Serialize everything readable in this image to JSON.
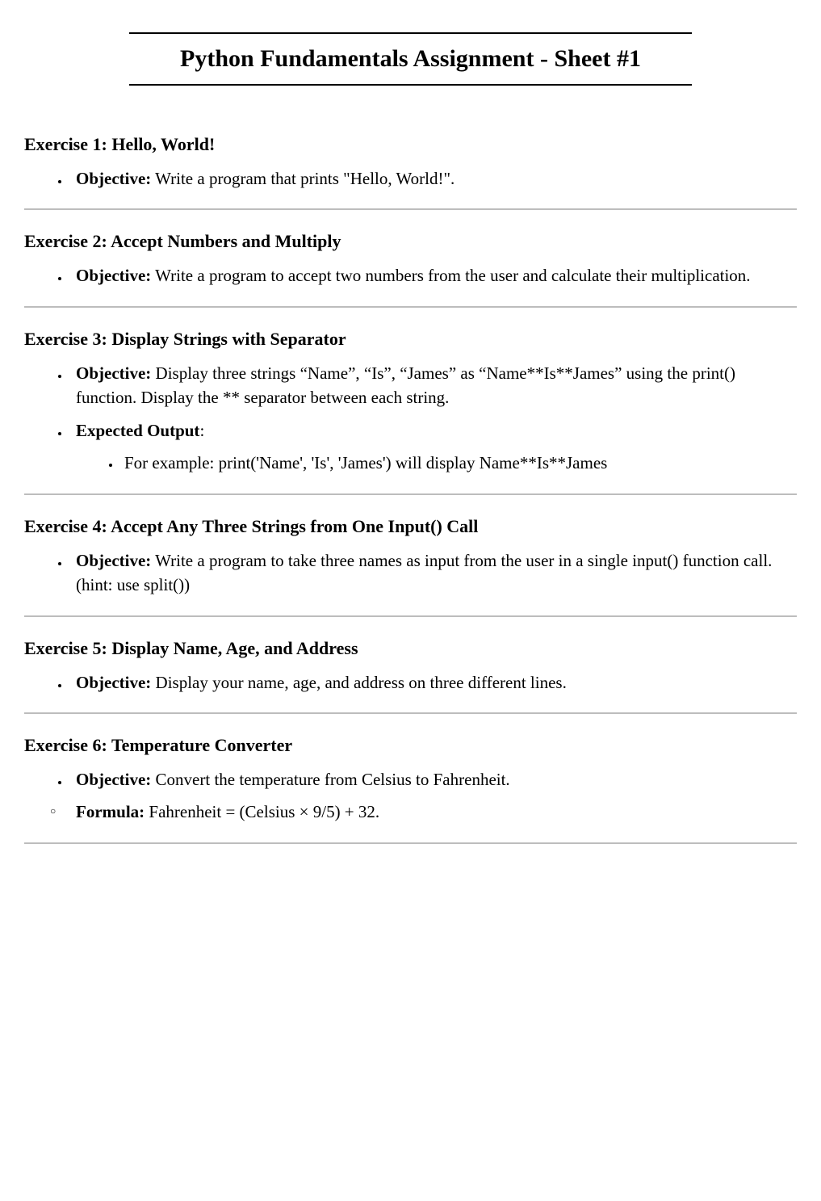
{
  "title": "Python Fundamentals Assignment - Sheet #1",
  "exercises": [
    {
      "heading": "Exercise 1: Hello, World!",
      "items": [
        {
          "type": "disc",
          "label": "Objective:",
          "text": " Write a program that prints \"Hello, World!\"."
        }
      ]
    },
    {
      "heading": "Exercise 2: Accept Numbers and Multiply",
      "items": [
        {
          "type": "disc",
          "label": "Objective:",
          "text": " Write a program to accept two numbers from the user and calculate their multiplication."
        }
      ]
    },
    {
      "heading": "Exercise 3: Display Strings with Separator",
      "items": [
        {
          "type": "disc",
          "label": "Objective:",
          "text": " Display three strings “Name”, “Is”, “James” as “Name**Is**James” using the print() function. Display the ** separator between each string."
        },
        {
          "type": "disc",
          "label": "Expected Output",
          "labelSuffix": ":",
          "text": "",
          "subitems": [
            {
              "text": "For example: print('Name', 'Is', 'James') will display Name**Is**James"
            }
          ]
        }
      ]
    },
    {
      "heading": "Exercise 4: Accept Any Three Strings from One Input() Call",
      "items": [
        {
          "type": "disc",
          "label": "Objective:",
          "text": " Write a program to take three names as input from the user in a single input() function call.(hint: use split())"
        }
      ]
    },
    {
      "heading": "Exercise 5: Display Name, Age, and Address",
      "items": [
        {
          "type": "disc",
          "label": "Objective:",
          "text": " Display your name, age, and address on three different lines."
        }
      ]
    },
    {
      "heading": "Exercise 6: Temperature Converter",
      "items": [
        {
          "type": "disc",
          "label": "Objective:",
          "text": " Convert the temperature from Celsius to Fahrenheit."
        },
        {
          "type": "circle",
          "label": "Formula:",
          "text": " Fahrenheit = (Celsius × 9/5) + 32."
        }
      ]
    }
  ]
}
